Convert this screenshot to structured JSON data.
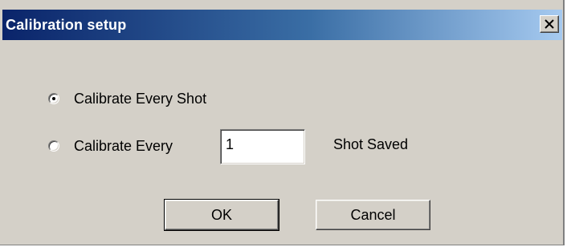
{
  "window": {
    "title": "Calibration setup",
    "close_symbol": "X"
  },
  "options": [
    {
      "label": "Calibrate Every Shot",
      "selected": true
    },
    {
      "label": "Calibrate Every",
      "selected": false
    }
  ],
  "interval": {
    "value": "1",
    "suffix": "Shot Saved"
  },
  "buttons": {
    "ok_label": "OK",
    "cancel_label": "Cancel"
  },
  "colors": {
    "title_start": "#0a246a",
    "title_end": "#a6caf0",
    "face": "#d4d0c8"
  },
  "icons": {
    "close": "close-icon"
  }
}
